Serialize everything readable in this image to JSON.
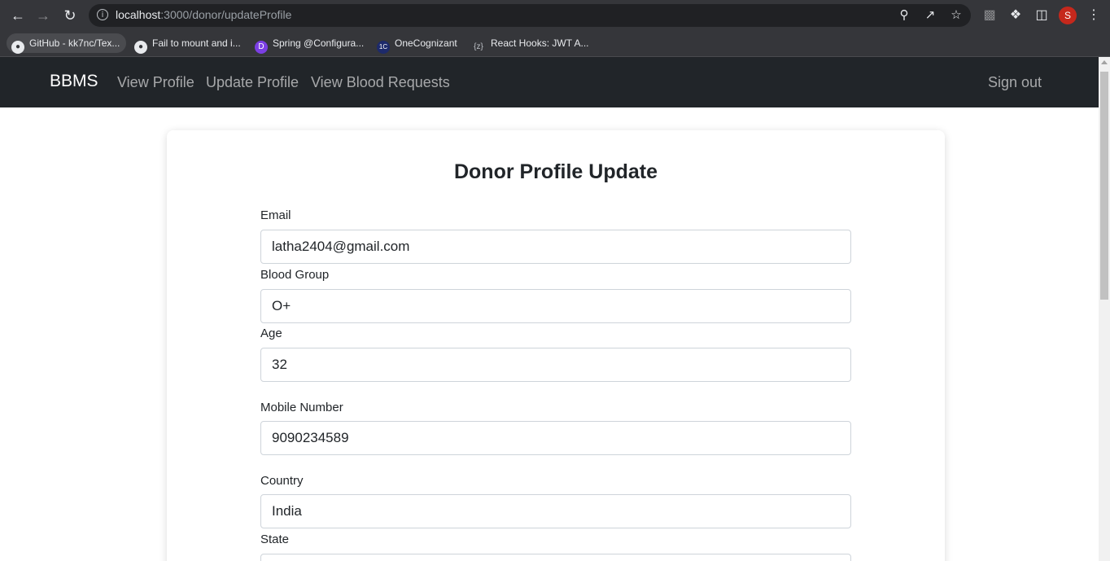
{
  "browser": {
    "url_host": "localhost",
    "url_path": ":3000/donor/updateProfile",
    "avatar_letter": "S",
    "bookmarks": [
      {
        "label": "GitHub - kk7nc/Tex...",
        "icon": "github-icon"
      },
      {
        "label": "Fail to mount and i...",
        "icon": "github-icon"
      },
      {
        "label": "Spring @Configura...",
        "icon": "spring-icon"
      },
      {
        "label": "OneCognizant",
        "icon": "onecognizant-icon"
      },
      {
        "label": "React Hooks: JWT A...",
        "icon": "brackets-icon"
      }
    ]
  },
  "navbar": {
    "brand": "BBMS",
    "links": [
      "View Profile",
      "Update Profile",
      "View Blood Requests"
    ],
    "signout": "Sign out"
  },
  "form": {
    "title": "Donor Profile Update",
    "fields": [
      {
        "label": "Email",
        "value": "latha2404@gmail.com"
      },
      {
        "label": "Blood Group",
        "value": "O+"
      },
      {
        "label": "Age",
        "value": "32"
      },
      {
        "label": "Mobile Number",
        "value": "9090234589"
      },
      {
        "label": "Country",
        "value": "India"
      },
      {
        "label": "State",
        "value": ""
      }
    ]
  }
}
